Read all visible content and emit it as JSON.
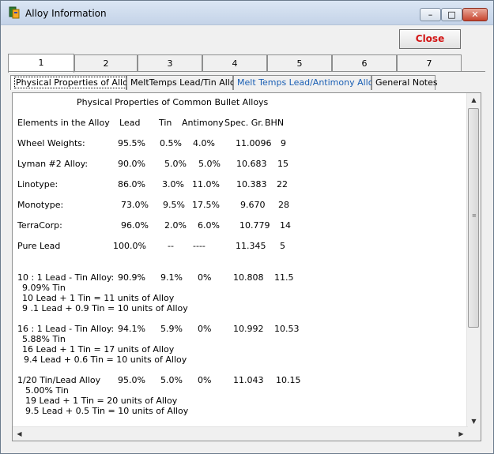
{
  "window": {
    "title": "Alloy Information",
    "close_label": "Close",
    "caption_min": "–",
    "caption_max": "□",
    "caption_close": "✕"
  },
  "number_tabs": [
    "1",
    "2",
    "3",
    "4",
    "5",
    "6",
    "7"
  ],
  "sub_tabs": [
    {
      "label": "Physical Properties of Alloys"
    },
    {
      "label": "MeltTemps Lead/Tin Alloys"
    },
    {
      "label": "Melt Temps Lead/Antimony Alloys"
    },
    {
      "label": "General Notes"
    }
  ],
  "content": {
    "heading": "Physical Properties of Common Bullet Alloys",
    "columns": [
      "Elements in the Alloy",
      "Lead",
      "Tin",
      "Antimony",
      "Spec. Gr.",
      "BHN"
    ],
    "rows": [
      {
        "name": "Wheel Weights:",
        "lead": "95.5%",
        "tin": "0.5%",
        "antimony": "4.0%",
        "spec": "11.0096",
        "bhn": "9"
      },
      {
        "name": "Lyman #2 Alloy:",
        "lead": "90.0%",
        "tin": "5.0%",
        "antimony": "5.0%",
        "spec": "10.683",
        "bhn": "15"
      },
      {
        "name": "Linotype:",
        "lead": "86.0%",
        "tin": "3.0%",
        "antimony": "11.0%",
        "spec": "10.383",
        "bhn": "22"
      },
      {
        "name": "Monotype:",
        "lead": "73.0%",
        "tin": "9.5%",
        "antimony": "17.5%",
        "spec": "9.670",
        "bhn": "28"
      },
      {
        "name": "TerraCorp:",
        "lead": "96.0%",
        "tin": "2.0%",
        "antimony": "6.0%",
        "spec": "10.779",
        "bhn": "14"
      },
      {
        "name": "Pure Lead",
        "lead": "100.0%",
        "tin": "--",
        "antimony": "----",
        "spec": "11.345",
        "bhn": "5"
      }
    ],
    "groups": [
      {
        "name": "10 : 1 Lead - Tin  Alloy:",
        "lead": "90.9%",
        "tin": "9.1%",
        "antimony": "0%",
        "spec": "10.808",
        "bhn": "11.5",
        "notes": [
          "9.09% Tin",
          "10   Lead +  1    Tin = 11 units of Alloy",
          "9 .1 Lead  + 0.9 Tin = 10 units of Alloy"
        ]
      },
      {
        "name": "16 : 1 Lead - Tin  Alloy:",
        "lead": "94.1%",
        "tin": "5.9%",
        "antimony": "0%",
        "spec": "10.992",
        "bhn": "10.53",
        "notes": [
          "5.88% Tin",
          "16  Lead + 1     Tin  = 17 units of Alloy",
          "9.4 Lead + 0.6 Tin = 10 units of Alloy"
        ]
      },
      {
        "name": "1/20  Tin/Lead Alloy",
        "lead": "95.0%",
        "tin": "5.0%",
        "antimony": "0%",
        "spec": "11.043",
        "bhn": "10.15",
        "notes": [
          "5.00% Tin",
          "19 Lead + 1     Tin = 20 units of Alloy",
          "9.5 Lead + 0.5 Tin = 10 units of Alloy"
        ]
      }
    ]
  },
  "scrollbar": {
    "up_glyph": "▲",
    "down_glyph": "▼",
    "left_glyph": "◀",
    "right_glyph": "▶",
    "grip": "≡"
  }
}
